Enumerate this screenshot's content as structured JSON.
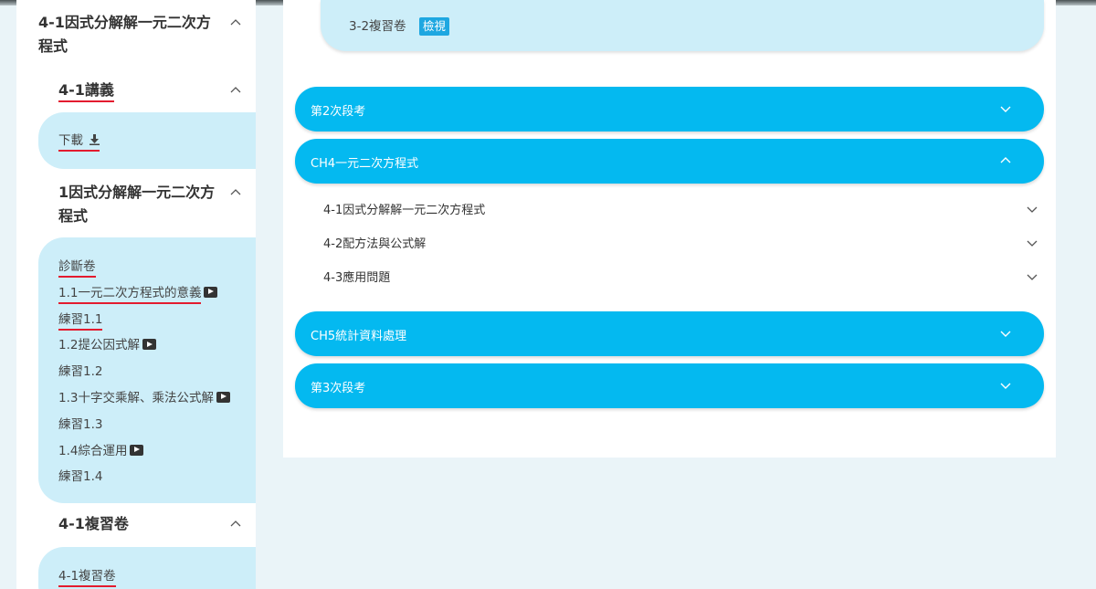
{
  "sidebar": {
    "chapter": {
      "title": "4-1因式分解解一元二次方程式"
    },
    "lecture": {
      "title": "4-1講義",
      "download_label": "下載"
    },
    "unit": {
      "title": "1因式分解解一元二次方程式",
      "items": [
        {
          "label": "診斷卷"
        },
        {
          "label": "1.1一元二次方程式的意義"
        },
        {
          "label": "練習1.1"
        },
        {
          "label": "1.2提公因式解"
        },
        {
          "label": "練習1.2"
        },
        {
          "label": "1.3十字交乘解、乘法公式解"
        },
        {
          "label": "練習1.3"
        },
        {
          "label": "1.4綜合運用"
        },
        {
          "label": "練習1.4"
        }
      ]
    },
    "review": {
      "title": "4-1複習卷",
      "item_label": "4-1複習卷"
    }
  },
  "main": {
    "top_item": {
      "label": "3-2複習卷",
      "badge": "檢視"
    },
    "sections": [
      {
        "title": "第2次段考",
        "expanded": false
      },
      {
        "title": "CH4一元二次方程式",
        "expanded": true,
        "subsections": [
          {
            "title": "4-1因式分解解一元二次方程式"
          },
          {
            "title": "4-2配方法與公式解"
          },
          {
            "title": "4-3應用問題"
          }
        ]
      },
      {
        "title": "CH5統計資料處理",
        "expanded": false
      },
      {
        "title": "第3次段考",
        "expanded": false
      }
    ]
  },
  "icons": {
    "chevron_up": "chevron-up-icon",
    "chevron_down": "chevron-down-icon",
    "download": "download-icon",
    "play": "play-icon"
  },
  "colors": {
    "accent": "#04b9f0",
    "light_panel": "#cdeef9",
    "badge": "#1ea7e1",
    "underline": "#e31b2f",
    "page_bg": "#eaf4f8"
  }
}
